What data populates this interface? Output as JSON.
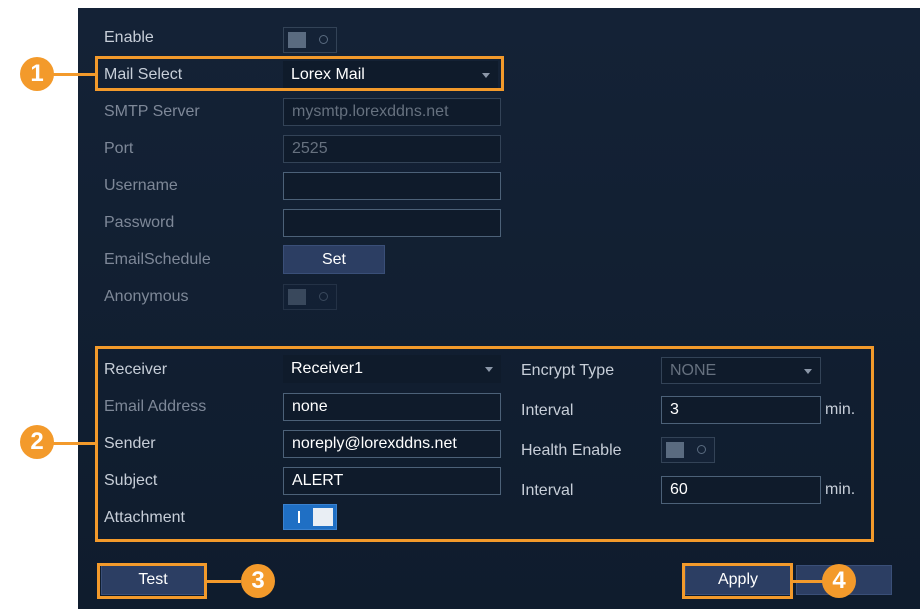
{
  "form": {
    "enable_label": "Enable",
    "mail_select_label": "Mail Select",
    "mail_select_value": "Lorex Mail",
    "smtp_server_label": "SMTP Server",
    "smtp_server_value": "mysmtp.lorexddns.net",
    "port_label": "Port",
    "port_value": "2525",
    "username_label": "Username",
    "username_value": "",
    "password_label": "Password",
    "password_value": "",
    "email_schedule_label": "EmailSchedule",
    "set_button": "Set",
    "anonymous_label": "Anonymous"
  },
  "receiver_section": {
    "receiver_label": "Receiver",
    "receiver_value": "Receiver1",
    "email_address_label": "Email Address",
    "email_address_value": "none",
    "sender_label": "Sender",
    "sender_value": "noreply@lorexddns.net",
    "subject_label": "Subject",
    "subject_value": "ALERT",
    "attachment_label": "Attachment",
    "encrypt_type_label": "Encrypt Type",
    "encrypt_type_value": "NONE",
    "interval_label": "Interval",
    "interval_value": "3",
    "interval_unit": "min.",
    "health_enable_label": "Health Enable",
    "health_interval_label": "Interval",
    "health_interval_value": "60",
    "health_interval_unit": "min."
  },
  "buttons": {
    "test": "Test",
    "apply": "Apply"
  },
  "callouts": [
    "1",
    "2",
    "3",
    "4"
  ],
  "colors": {
    "panel_bg": "#142236",
    "callout_orange": "#f39a2b",
    "toggle_on": "#1f6fc4",
    "button_bg": "#2c3e63"
  }
}
